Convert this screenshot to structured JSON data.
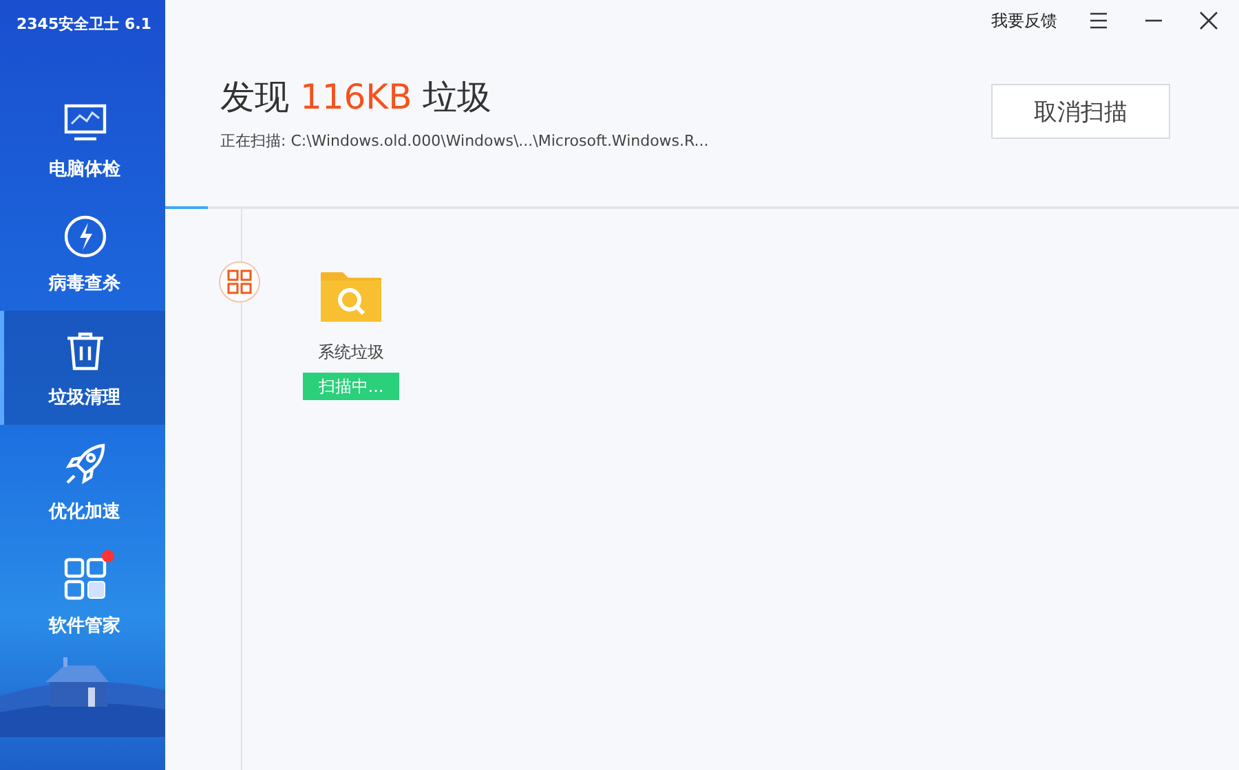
{
  "app": {
    "title": "2345安全卫士 6.1"
  },
  "nav": [
    {
      "label": "电脑体检",
      "selected": false,
      "notification": false
    },
    {
      "label": "病毒查杀",
      "selected": false,
      "notification": false
    },
    {
      "label": "垃圾清理",
      "selected": true,
      "notification": false
    },
    {
      "label": "优化加速",
      "selected": false,
      "notification": false
    },
    {
      "label": "软件管家",
      "selected": false,
      "notification": true
    }
  ],
  "titlebar": {
    "feedback": "我要反馈"
  },
  "header": {
    "title": "发现 **116KB** 垃圾",
    "scanning_label": "正在扫描:",
    "scanning_path": "C:\\Windows.old.000\\Windows\\...\\Microsoft.Windows.R...",
    "cancel": "取消扫描"
  },
  "scan_progress": {
    "level": 0.04
  },
  "categories": [
    {
      "label": "系统垃圾",
      "status": "扫描中..."
    }
  ]
}
